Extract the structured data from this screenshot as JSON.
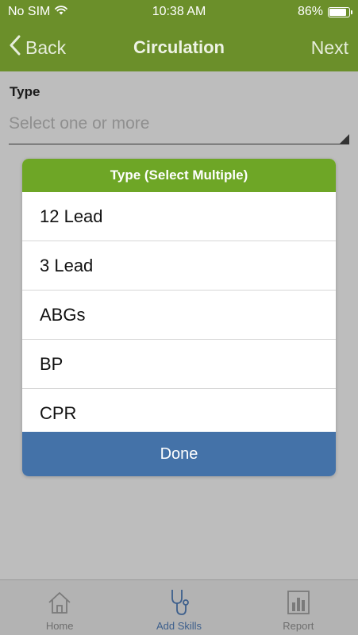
{
  "status_bar": {
    "carrier": "No SIM",
    "time": "10:38 AM",
    "battery_percent": "86%",
    "battery_level": 0.86,
    "wifi_icon": "wifi-icon",
    "battery_icon": "battery-icon"
  },
  "nav": {
    "back_label": "Back",
    "title": "Circulation",
    "next_label": "Next",
    "bar_color": "#6b8f2a"
  },
  "form": {
    "type_label": "Type",
    "type_placeholder": "Select one or more"
  },
  "modal": {
    "title": "Type (Select Multiple)",
    "header_color": "#6ea626",
    "items": [
      {
        "label": "12 Lead"
      },
      {
        "label": "3 Lead"
      },
      {
        "label": "ABGs"
      },
      {
        "label": "BP"
      },
      {
        "label": "CPR"
      }
    ],
    "done_label": "Done",
    "done_color": "#4472a8"
  },
  "tabs": [
    {
      "label": "Home",
      "icon": "house-icon",
      "active": false
    },
    {
      "label": "Add Skills",
      "icon": "stethoscope-icon",
      "active": true
    },
    {
      "label": "Report",
      "icon": "report-icon",
      "active": false
    }
  ]
}
